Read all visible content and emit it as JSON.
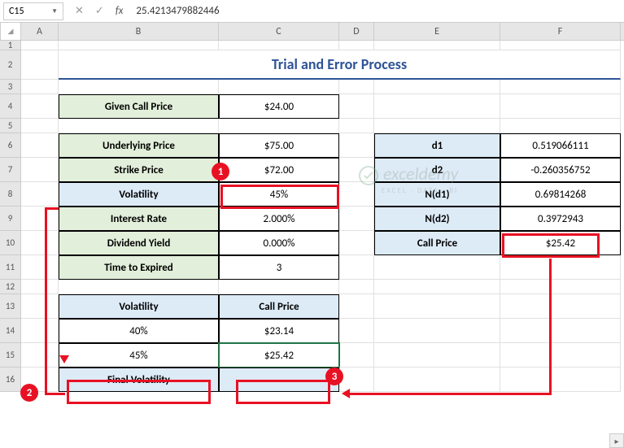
{
  "namebox": "C15",
  "formula": "25.4213479882446",
  "cols": [
    "",
    "A",
    "B",
    "C",
    "D",
    "E",
    "F"
  ],
  "rows": [
    "1",
    "2",
    "3",
    "4",
    "5",
    "6",
    "7",
    "8",
    "9",
    "10",
    "11",
    "12",
    "13",
    "14",
    "15",
    "16"
  ],
  "title": "Trial and Error Process",
  "r4": {
    "b": "Given Call Price",
    "c": "$24.00"
  },
  "r6": {
    "b": "Underlying Price",
    "c": "$75.00",
    "e": "d1",
    "f": "0.519066111"
  },
  "r7": {
    "b": "Strike Price",
    "c": "$72.00",
    "e": "d2",
    "f": "-0.260356752"
  },
  "r8": {
    "b": "Volatility",
    "c": "45%",
    "e": "N(d1)",
    "f": "0.69814268"
  },
  "r9": {
    "b": "Interest Rate",
    "c": "2.000%",
    "e": "N(d2)",
    "f": "0.3972943"
  },
  "r10": {
    "b": "Dividend Yield",
    "c": "0.000%",
    "e": "Call Price",
    "f": "$25.42"
  },
  "r11": {
    "b": "Time to Expired",
    "c": "3"
  },
  "r13": {
    "b": "Volatility",
    "c": "Call Price"
  },
  "r14": {
    "b": "40%",
    "c": "$23.14"
  },
  "r15": {
    "b": "45%",
    "c": "$25.42"
  },
  "r16": {
    "b": "Final Volatility"
  },
  "marker1": "1",
  "marker2": "2",
  "marker3": "3",
  "watermark": "exceldemy",
  "watermark_sub": "EXCEL · DATA · BI",
  "chart_data": {
    "type": "table",
    "title": "Trial and Error Process",
    "inputs": {
      "Given Call Price": 24.0,
      "Underlying Price": 75.0,
      "Strike Price": 72.0,
      "Volatility": 0.45,
      "Interest Rate": 0.02,
      "Dividend Yield": 0.0,
      "Time to Expired": 3
    },
    "outputs": {
      "d1": 0.519066111,
      "d2": -0.260356752,
      "N(d1)": 0.69814268,
      "N(d2)": 0.3972943,
      "Call Price": 25.42
    },
    "trials": [
      {
        "Volatility": 0.4,
        "Call Price": 23.14
      },
      {
        "Volatility": 0.45,
        "Call Price": 25.42
      }
    ]
  }
}
